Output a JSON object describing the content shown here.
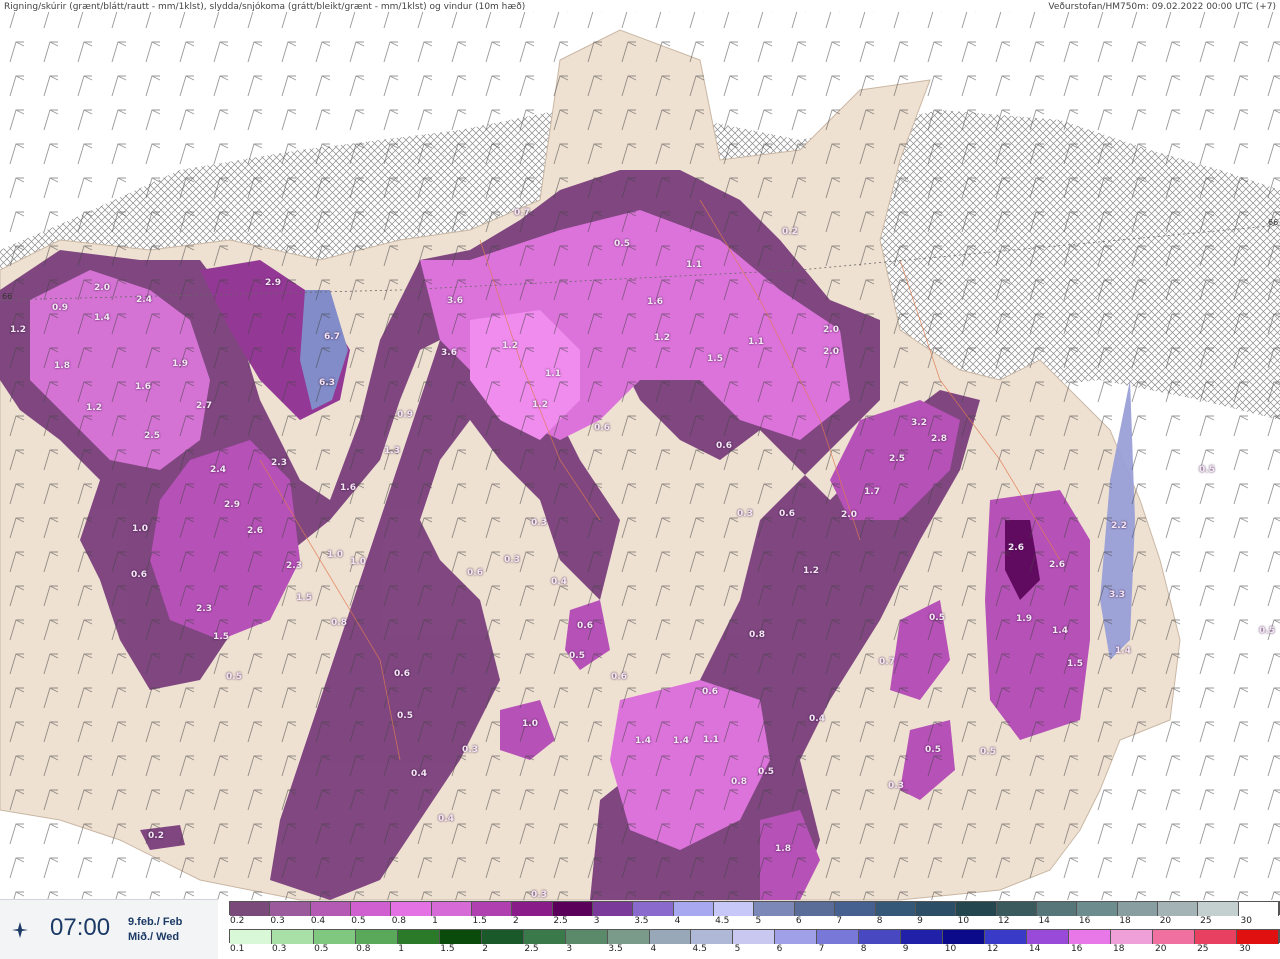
{
  "header": {
    "title_left": "Rigning/skúrir (grænt/blátt/rautt - mm/1klst), slydda/snjókoma (grátt/bleikt/grænt - mm/1klst) og vindur (10m hæð)",
    "title_right": "Veðurstofan/HM750m: 09.02.2022 00:00 UTC (+7)"
  },
  "latitude_labels": [
    "66",
    "66"
  ],
  "map_labels": [
    {
      "t": "1.2"
    },
    {
      "t": "0.9"
    },
    {
      "t": "2.0"
    },
    {
      "t": "1.4"
    },
    {
      "t": "2.4"
    },
    {
      "t": "1.8"
    },
    {
      "t": "1.2"
    },
    {
      "t": "1.6"
    },
    {
      "t": "1.9"
    },
    {
      "t": "2.7"
    },
    {
      "t": "2.5"
    },
    {
      "t": "2.9"
    },
    {
      "t": "6.7"
    },
    {
      "t": "6.3"
    },
    {
      "t": "3.6"
    },
    {
      "t": "3.6"
    },
    {
      "t": "0.9"
    },
    {
      "t": "1.3"
    },
    {
      "t": "2.3"
    },
    {
      "t": "2.4"
    },
    {
      "t": "2.9"
    },
    {
      "t": "2.6"
    },
    {
      "t": "1.6"
    },
    {
      "t": "1.0"
    },
    {
      "t": "1.0"
    },
    {
      "t": "1.0"
    },
    {
      "t": "0.6"
    },
    {
      "t": "2.3"
    },
    {
      "t": "1.5"
    },
    {
      "t": "2.3"
    },
    {
      "t": "1.5"
    },
    {
      "t": "0.8"
    },
    {
      "t": "0.5"
    },
    {
      "t": "0.6"
    },
    {
      "t": "0.5"
    },
    {
      "t": "0.7"
    },
    {
      "t": "0.5"
    },
    {
      "t": "1.1"
    },
    {
      "t": "1.6"
    },
    {
      "t": "1.2"
    },
    {
      "t": "1.2"
    },
    {
      "t": "1.1"
    },
    {
      "t": "1.2"
    },
    {
      "t": "1.5"
    },
    {
      "t": "1.1"
    },
    {
      "t": "2.0"
    },
    {
      "t": "2.0"
    },
    {
      "t": "0.2"
    },
    {
      "t": "0.6"
    },
    {
      "t": "0.6"
    },
    {
      "t": "0.3"
    },
    {
      "t": "0.3"
    },
    {
      "t": "0.6"
    },
    {
      "t": "0.4"
    },
    {
      "t": "0.6"
    },
    {
      "t": "0.5"
    },
    {
      "t": "0.3"
    },
    {
      "t": "0.6"
    },
    {
      "t": "3.2"
    },
    {
      "t": "2.8"
    },
    {
      "t": "2.5"
    },
    {
      "t": "1.7"
    },
    {
      "t": "2.0"
    },
    {
      "t": "1.2"
    },
    {
      "t": "0.8"
    },
    {
      "t": "0.5"
    },
    {
      "t": "0.7"
    },
    {
      "t": "2.6"
    },
    {
      "t": "2.6"
    },
    {
      "t": "1.9"
    },
    {
      "t": "1.4"
    },
    {
      "t": "1.5"
    },
    {
      "t": "2.2"
    },
    {
      "t": "3.3"
    },
    {
      "t": "1.4"
    },
    {
      "t": "1.0"
    },
    {
      "t": "0.3"
    },
    {
      "t": "0.4"
    },
    {
      "t": "0.4"
    },
    {
      "t": "1.4"
    },
    {
      "t": "1.4"
    },
    {
      "t": "1.1"
    },
    {
      "t": "0.8"
    },
    {
      "t": "0.6"
    },
    {
      "t": "0.5"
    },
    {
      "t": "0.4"
    },
    {
      "t": "0.5"
    },
    {
      "t": "0.5"
    },
    {
      "t": "0.5"
    },
    {
      "t": "0.3"
    },
    {
      "t": "1.8"
    },
    {
      "t": "0.2"
    },
    {
      "t": "0.3"
    },
    {
      "t": "0.6"
    },
    {
      "t": "0.5"
    }
  ],
  "time_panel": {
    "time": "07:00",
    "date_line1": "9.feb./ Feb",
    "date_line2": "Mið./ Wed",
    "play_icon": "wind-vane-icon"
  },
  "scale_top": {
    "ticks": [
      "0.2",
      "0.3",
      "0.4",
      "0.5",
      "0.8",
      "1",
      "1.5",
      "2",
      "2.5",
      "3",
      "3.5",
      "4",
      "4.5",
      "5",
      "6",
      "7",
      "8",
      "9",
      "10",
      "12",
      "14",
      "16",
      "18",
      "20",
      "25",
      "30"
    ],
    "colors": [
      "#7a4a7a",
      "#9b5a9b",
      "#b45ab4",
      "#d060d0",
      "#e472e4",
      "#d66ad6",
      "#b040b0",
      "#8a1c8a",
      "#5a005a",
      "#7a3a9a",
      "#8a6acc",
      "#a8a8f0",
      "#c8c8f8",
      "#7c88b8",
      "#5a6c98",
      "#466090",
      "#355878",
      "#2c4e66",
      "#24464e",
      "#3a5a5e",
      "#56767a",
      "#6c8c8e",
      "#889ea0",
      "#a4b4b6",
      "#c4d0d0",
      "#ffffff"
    ]
  },
  "scale_bottom": {
    "ticks": [
      "0.1",
      "0.3",
      "0.5",
      "0.8",
      "1",
      "1.5",
      "2",
      "2.5",
      "3",
      "3.5",
      "4",
      "4.5",
      "5",
      "6",
      "7",
      "8",
      "9",
      "10",
      "12",
      "14",
      "16",
      "18",
      "20",
      "25",
      "30"
    ],
    "colors": [
      "#d8f8d8",
      "#a8e0a8",
      "#80c880",
      "#5aa85a",
      "#2a7a2a",
      "#0a4a0a",
      "#1a5a2a",
      "#3a7a4a",
      "#5a8a6a",
      "#7a9a8a",
      "#98a8b8",
      "#b0b8d8",
      "#c8c8f0",
      "#a0a0e8",
      "#7878d8",
      "#4848c0",
      "#2020a8",
      "#0a0a8a",
      "#3a3ac8",
      "#9a4ad8",
      "#e878e8",
      "#f0a0d8",
      "#f070a0",
      "#e84060",
      "#e01010"
    ]
  }
}
